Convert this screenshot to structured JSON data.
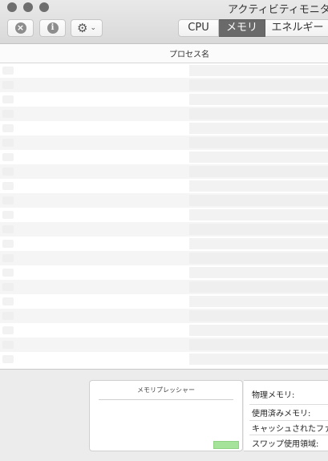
{
  "window": {
    "title": "アクティビティモニタ"
  },
  "toolbar": {
    "stop_icon": "stop-process-icon",
    "info_icon": "info-icon",
    "gear_icon": "gear-icon",
    "stop_glyph": "×",
    "info_glyph": "i",
    "gear_glyph": "⚙",
    "chevron_glyph": "⌄"
  },
  "tabs": [
    {
      "label": "CPU",
      "selected": false
    },
    {
      "label": "メモリ",
      "selected": true
    },
    {
      "label": "エネルギー",
      "selected": false
    }
  ],
  "columns": {
    "process_name": "プロセス名"
  },
  "process_rows": 21,
  "memory_pressure": {
    "title": "メモリプレッシャー",
    "color": "#a6e39a"
  },
  "stats": [
    {
      "label": "物理メモリ:"
    },
    {
      "label": "使用済みメモリ:"
    },
    {
      "label": "キャッシュされたファ"
    },
    {
      "label": "スワップ使用領域:"
    }
  ],
  "colors": {
    "selected_tab": "#6a6a6a",
    "pressure_green": "#a6e39a"
  }
}
